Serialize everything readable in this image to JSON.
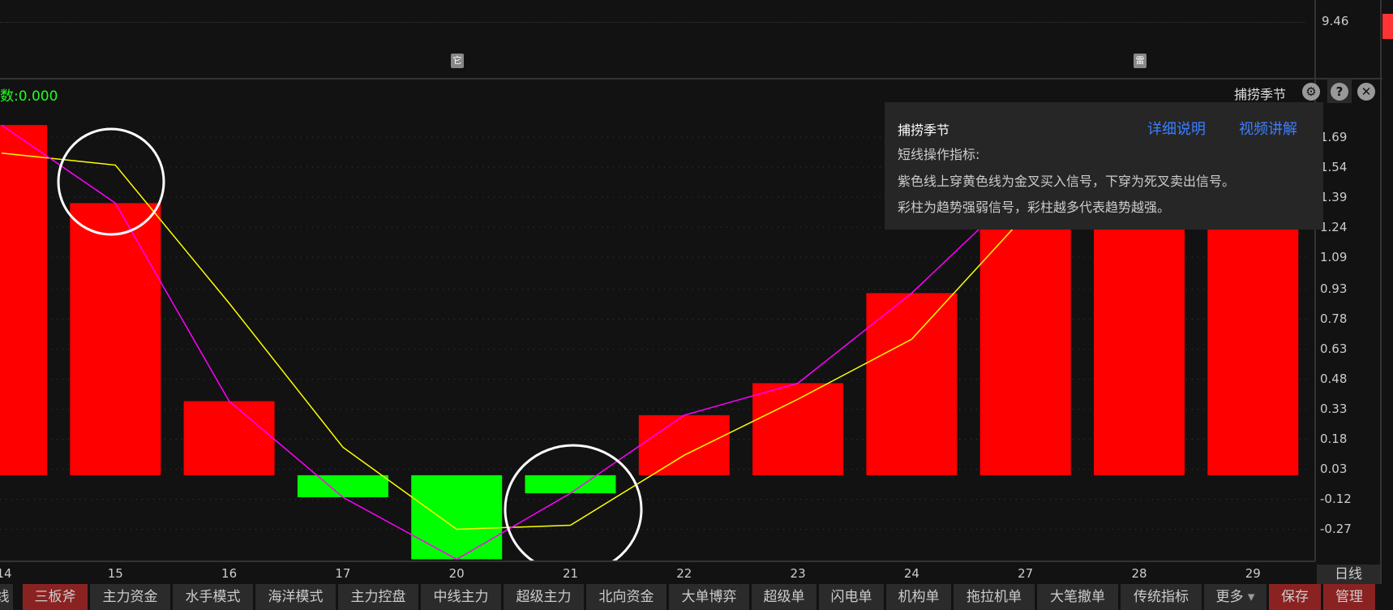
{
  "top_panel": {
    "price_label": "9.46",
    "markers": [
      "它",
      "雷"
    ]
  },
  "indicator": {
    "value_label": "数:0.000",
    "name": "捕捞季节",
    "icons": [
      "gear-icon",
      "help-icon",
      "close-icon"
    ]
  },
  "tooltip": {
    "title": "捕捞季节",
    "link_detail": "详细说明",
    "link_video": "视频讲解",
    "lines": [
      "短线操作指标:",
      "紫色线上穿黄色线为金叉买入信号，下穿为死叉卖出信号。",
      "彩柱为趋势强弱信号，彩柱越多代表趋势越强。"
    ]
  },
  "period_label": "日线",
  "tabs": [
    {
      "label": "线"
    },
    {
      "label": "三板斧",
      "active": true
    },
    {
      "label": "主力资金"
    },
    {
      "label": "水手模式"
    },
    {
      "label": "海洋模式"
    },
    {
      "label": "主力控盘"
    },
    {
      "label": "中线主力"
    },
    {
      "label": "超级主力"
    },
    {
      "label": "北向资金"
    },
    {
      "label": "大单博弈"
    },
    {
      "label": "超级单"
    },
    {
      "label": "闪电单"
    },
    {
      "label": "机构单"
    },
    {
      "label": "拖拉机单"
    },
    {
      "label": "大笔撤单"
    },
    {
      "label": "传统指标"
    },
    {
      "label": "更多"
    },
    {
      "label": "保存"
    },
    {
      "label": "管理"
    }
  ],
  "chart_data": {
    "type": "bar",
    "categories": [
      "14",
      "15",
      "16",
      "17",
      "20",
      "21",
      "22",
      "23",
      "24",
      "27",
      "28",
      "29"
    ],
    "y_ticks": [
      "1.69",
      "1.54",
      "1.39",
      "1.24",
      "1.09",
      "0.93",
      "0.78",
      "0.63",
      "0.48",
      "0.33",
      "0.18",
      "0.03",
      "-0.12",
      "-0.27"
    ],
    "ylim": [
      -0.42,
      1.75
    ],
    "grid": true,
    "series": [
      {
        "kind": "bar",
        "values": [
          1.75,
          1.36,
          0.37,
          -0.11,
          -0.42,
          -0.09,
          0.3,
          0.46,
          0.91,
          1.5,
          1.5,
          1.5
        ]
      },
      {
        "kind": "line",
        "color": "#ff00ff",
        "values": [
          1.75,
          1.36,
          0.37,
          -0.11,
          -0.42,
          -0.09,
          0.3,
          0.46,
          0.91,
          1.45,
          null,
          null
        ]
      },
      {
        "kind": "line",
        "color": "#ffff00",
        "values": [
          1.61,
          1.55,
          0.86,
          0.14,
          -0.27,
          -0.25,
          0.1,
          0.38,
          0.68,
          1.3,
          null,
          null
        ]
      }
    ],
    "colors": {
      "up": "#ff0000",
      "down": "#00ff00"
    },
    "annotations": [
      "circle around 15",
      "circle around 21"
    ]
  }
}
